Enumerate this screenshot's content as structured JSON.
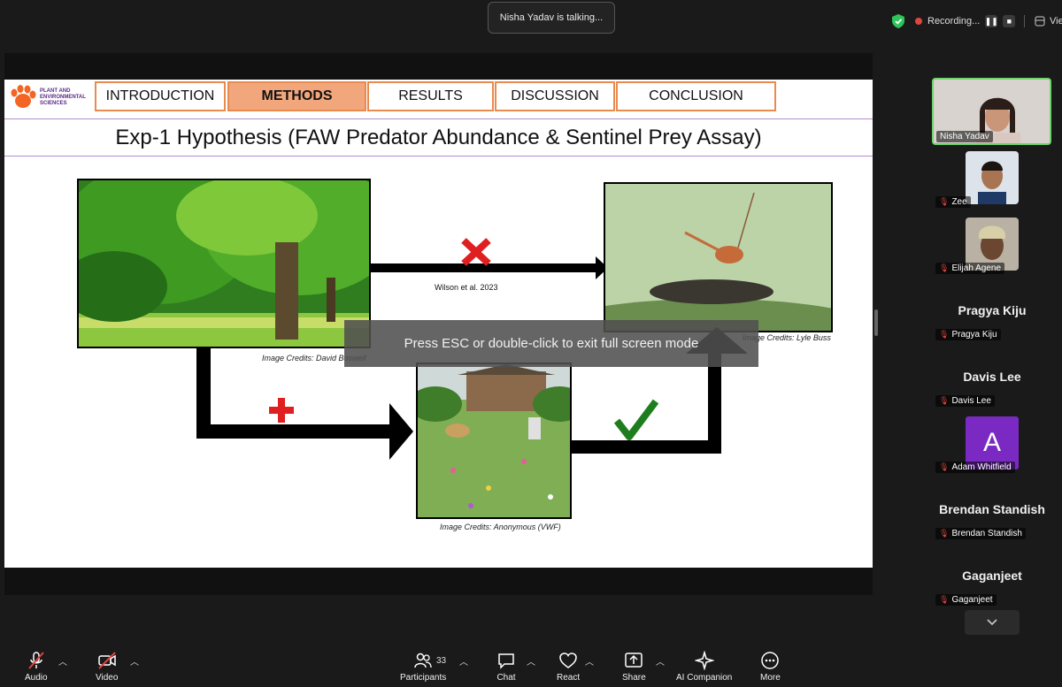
{
  "banner": {
    "talking": "Nisha Yadav is talking..."
  },
  "recording": {
    "label": "Recording...",
    "view_label": "Vie"
  },
  "slide": {
    "logo_text": "PLANT AND\nENVIRONMENTAL\nSCIENCES",
    "nav": [
      "INTRODUCTION",
      "METHODS",
      "RESULTS",
      "DISCUSSION",
      "CONCLUSION"
    ],
    "active_nav": "METHODS",
    "title": "Exp-1 Hypothesis (FAW Predator Abundance & Sentinel Prey Assay)",
    "citation": "Wilson et al. 2023",
    "credits": {
      "forest": "Image Credits: David Boswell",
      "insect": "Image Credits: Lyle Buss",
      "garden": "Image Credits: Anonymous (VWF)"
    },
    "colors": {
      "accent_orange": "#e98b4f",
      "active_tab": "#f2a67c",
      "cross": "#e02020",
      "check": "#1e7e1e"
    }
  },
  "overlay": {
    "esc_message": "Press ESC or double-click to exit full screen mode"
  },
  "participants_panel": {
    "video_tile": {
      "name": "Nisha Yadav"
    },
    "tiles": [
      {
        "name": "Zee",
        "muted": true
      },
      {
        "name": "Elijah Agene",
        "muted": true
      },
      {
        "display": "Pragya Kiju",
        "name": "Pragya Kiju",
        "muted": true
      },
      {
        "display": "Davis Lee",
        "name": "Davis Lee",
        "muted": true
      },
      {
        "initial": "A",
        "name": "Adam Whitfield",
        "muted": true
      },
      {
        "display": "Brendan Standish",
        "name": "Brendan Standish",
        "muted": true
      },
      {
        "display": "Gaganjeet",
        "name": "Gaganjeet",
        "muted": true
      }
    ]
  },
  "toolbar": {
    "audio": "Audio",
    "video": "Video",
    "participants": "Participants",
    "participants_count": "33",
    "chat": "Chat",
    "react": "React",
    "share": "Share",
    "ai_companion": "AI Companion",
    "more": "More"
  }
}
